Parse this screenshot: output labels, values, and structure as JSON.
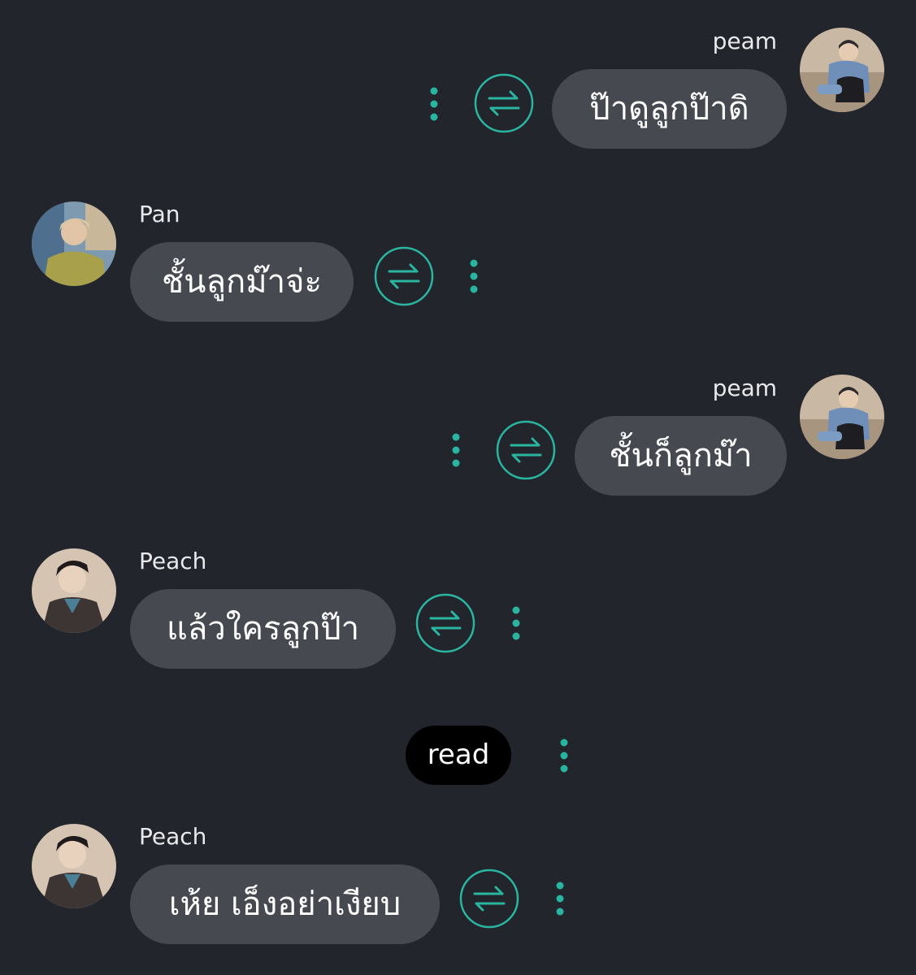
{
  "messages": [
    {
      "sender": "peam",
      "text": "ป๊าดูลูกป๊าดิ",
      "side": "right"
    },
    {
      "sender": "Pan",
      "text": "ชั้นลูกม๊าจ่ะ",
      "side": "left"
    },
    {
      "sender": "peam",
      "text": "ชั้นก็ลูกม๊า",
      "side": "right"
    },
    {
      "sender": "Peach",
      "text": "แล้วใครลูกป๊า",
      "side": "left"
    },
    {
      "sender": "Peach",
      "text": "เห้ย เอ็งอย่าเงียบ",
      "side": "left"
    }
  ],
  "status": {
    "read_label": "read"
  },
  "icons": {
    "swap": "swap-arrows-icon",
    "more": "more-vertical-icon",
    "avatar": "avatar-photo"
  },
  "colors": {
    "background": "#23252c",
    "bubble": "#474951",
    "accent": "#2ab5a0",
    "read_pill": "#000000"
  }
}
